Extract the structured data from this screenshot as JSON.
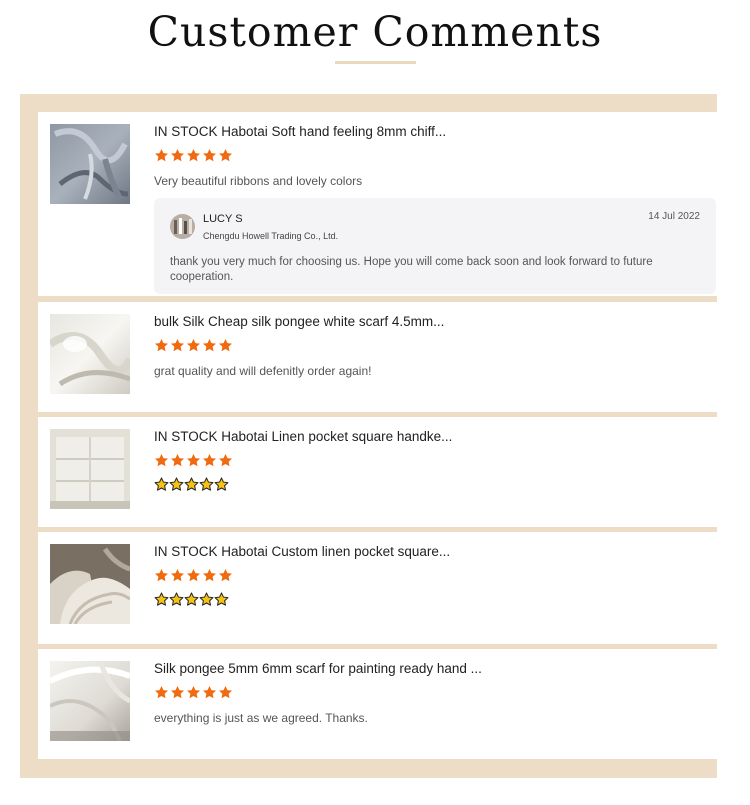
{
  "page": {
    "title": "Customer Comments"
  },
  "colors": {
    "panel_background": "#eddcc6",
    "star_orange": "#f06a0f",
    "emoji_star_gold": "#f5c315"
  },
  "reviews": [
    {
      "product_title": "IN STOCK Habotai Soft hand feeling 8mm chiff...",
      "rating": 5,
      "comment": "Very beautiful ribbons and lovely colors",
      "comment_type": "text",
      "thumbnail": "grey-silk-ribbons-photo",
      "seller_reply": {
        "name": "LUCY S",
        "company": "Chengdu Howell Trading Co., Ltd.",
        "date": "14 Jul 2022",
        "text": "thank you very much for choosing us.  Hope you will come back soon and look forward to future cooperation.",
        "avatar": "seller-avatar-icon"
      }
    },
    {
      "product_title": "bulk Silk Cheap silk pongee white scarf 4.5mm...",
      "rating": 5,
      "comment": "grat quality and will defenitly order again!",
      "comment_type": "text",
      "thumbnail": "white-silk-scarf-photo"
    },
    {
      "product_title": "IN STOCK Habotai Linen pocket square handke...",
      "rating": 5,
      "comment": "⭐⭐⭐⭐⭐",
      "comment_type": "emoji-stars",
      "emoji_star_count": 5,
      "thumbnail": "linen-handkerchief-photo"
    },
    {
      "product_title": "IN STOCK Habotai Custom linen pocket square...",
      "rating": 5,
      "comment": "⭐⭐⭐⭐⭐",
      "comment_type": "emoji-stars",
      "emoji_star_count": 5,
      "thumbnail": "linen-pocket-square-stack-photo"
    },
    {
      "product_title": "Silk pongee 5mm 6mm scarf for painting ready hand ...",
      "rating": 5,
      "comment": "everything is just as we agreed. Thanks.",
      "comment_type": "text",
      "thumbnail": "silk-pongee-scarf-photo"
    }
  ]
}
